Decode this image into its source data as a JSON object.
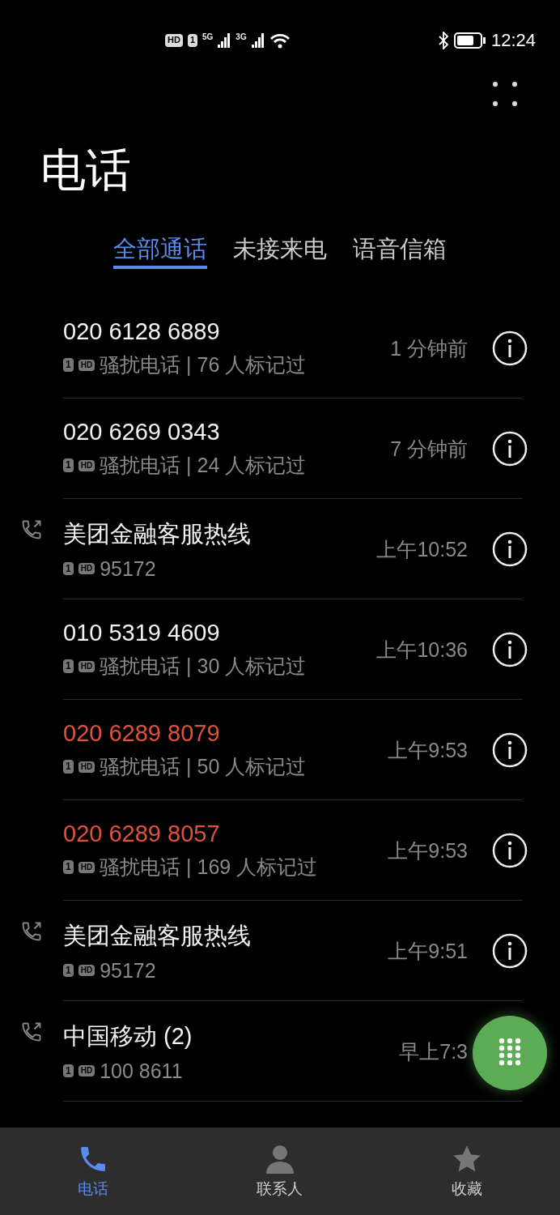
{
  "status_bar": {
    "hd": "HD",
    "sim": "1",
    "sim1_network": "5G",
    "sim2_network": "3G",
    "time": "12:24"
  },
  "title": "电话",
  "tabs": [
    {
      "label": "全部通话",
      "selected": true
    },
    {
      "label": "未接来电",
      "selected": false
    },
    {
      "label": "语音信箱",
      "selected": false
    }
  ],
  "calls": [
    {
      "name": "020 6128 6889",
      "missed": false,
      "outgoing": false,
      "sim": "1",
      "hd": "HD",
      "detail": "骚扰电话 | 76 人标记过",
      "time": "1 分钟前"
    },
    {
      "name": "020 6269 0343",
      "missed": false,
      "outgoing": false,
      "sim": "1",
      "hd": "HD",
      "detail": "骚扰电话 | 24 人标记过",
      "time": "7 分钟前"
    },
    {
      "name": "美团金融客服热线",
      "missed": false,
      "outgoing": true,
      "sim": "1",
      "hd": "HD",
      "detail": "95172",
      "time": "上午10:52"
    },
    {
      "name": "010 5319 4609",
      "missed": false,
      "outgoing": false,
      "sim": "1",
      "hd": "HD",
      "detail": "骚扰电话 | 30 人标记过",
      "time": "上午10:36"
    },
    {
      "name": "020 6289 8079",
      "missed": true,
      "outgoing": false,
      "sim": "1",
      "hd": "HD",
      "detail": "骚扰电话 | 50 人标记过",
      "time": "上午9:53"
    },
    {
      "name": "020 6289 8057",
      "missed": true,
      "outgoing": false,
      "sim": "1",
      "hd": "HD",
      "detail": "骚扰电话 | 169 人标记过",
      "time": "上午9:53"
    },
    {
      "name": "美团金融客服热线",
      "missed": false,
      "outgoing": true,
      "sim": "1",
      "hd": "HD",
      "detail": "95172",
      "time": "上午9:51"
    },
    {
      "name": "中国移动 (2)",
      "missed": false,
      "outgoing": true,
      "sim": "1",
      "hd": "HD",
      "detail": "100 8611",
      "time": "早上7:3"
    }
  ],
  "bottom_nav": [
    {
      "label": "电话",
      "selected": true,
      "kind": "phone"
    },
    {
      "label": "联系人",
      "selected": false,
      "kind": "contacts"
    },
    {
      "label": "收藏",
      "selected": false,
      "kind": "favorites"
    }
  ]
}
